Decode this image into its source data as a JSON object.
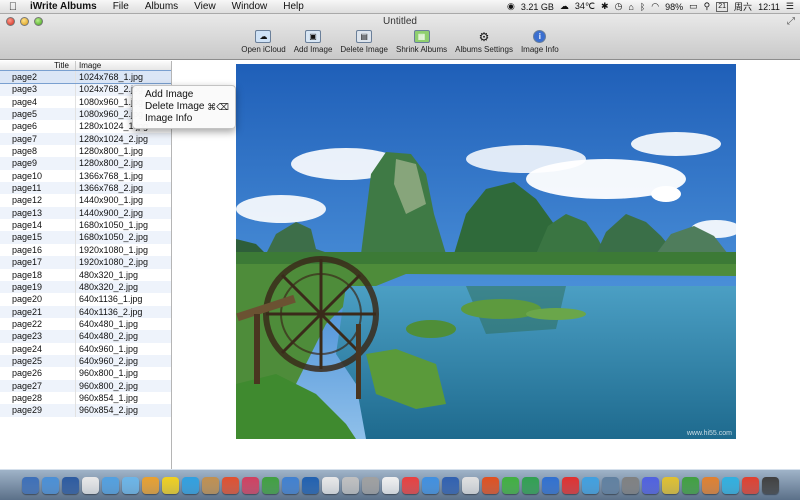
{
  "menubar": {
    "app_name": "iWrite Albums",
    "menus": [
      "File",
      "Albums",
      "View",
      "Window",
      "Help"
    ],
    "status": {
      "disk": "3.21 GB",
      "temperature": "34℃",
      "battery": "98%",
      "input_box": "21",
      "weekday": "周六",
      "time": "12:11"
    }
  },
  "window": {
    "title": "Untitled"
  },
  "toolbar": [
    {
      "label": "Open iCloud",
      "icon": "cloud-icon"
    },
    {
      "label": "Add Image",
      "icon": "add-image-icon"
    },
    {
      "label": "Delete Image",
      "icon": "delete-image-icon"
    },
    {
      "label": "Shrink Albums",
      "icon": "shrink-icon"
    },
    {
      "label": "Albums Settings",
      "icon": "gear-icon"
    },
    {
      "label": "Image Info",
      "icon": "info-icon"
    }
  ],
  "list": {
    "headers": {
      "title": "Title",
      "image": "Image"
    },
    "selected_index": 0,
    "rows": [
      {
        "title": "page2",
        "image": "1024x768_1.jpg"
      },
      {
        "title": "page3",
        "image": "1024x768_2.jpg"
      },
      {
        "title": "page4",
        "image": "1080x960_1.jpg"
      },
      {
        "title": "page5",
        "image": "1080x960_2.jpg"
      },
      {
        "title": "page6",
        "image": "1280x1024_1.jpg"
      },
      {
        "title": "page7",
        "image": "1280x1024_2.jpg"
      },
      {
        "title": "page8",
        "image": "1280x800_1.jpg"
      },
      {
        "title": "page9",
        "image": "1280x800_2.jpg"
      },
      {
        "title": "page10",
        "image": "1366x768_1.jpg"
      },
      {
        "title": "page11",
        "image": "1366x768_2.jpg"
      },
      {
        "title": "page12",
        "image": "1440x900_1.jpg"
      },
      {
        "title": "page13",
        "image": "1440x900_2.jpg"
      },
      {
        "title": "page14",
        "image": "1680x1050_1.jpg"
      },
      {
        "title": "page15",
        "image": "1680x1050_2.jpg"
      },
      {
        "title": "page16",
        "image": "1920x1080_1.jpg"
      },
      {
        "title": "page17",
        "image": "1920x1080_2.jpg"
      },
      {
        "title": "page18",
        "image": "480x320_1.jpg"
      },
      {
        "title": "page19",
        "image": "480x320_2.jpg"
      },
      {
        "title": "page20",
        "image": "640x1136_1.jpg"
      },
      {
        "title": "page21",
        "image": "640x1136_2.jpg"
      },
      {
        "title": "page22",
        "image": "640x480_1.jpg"
      },
      {
        "title": "page23",
        "image": "640x480_2.jpg"
      },
      {
        "title": "page24",
        "image": "640x960_1.jpg"
      },
      {
        "title": "page25",
        "image": "640x960_2.jpg"
      },
      {
        "title": "page26",
        "image": "960x800_1.jpg"
      },
      {
        "title": "page27",
        "image": "960x800_2.jpg"
      },
      {
        "title": "page28",
        "image": "960x854_1.jpg"
      },
      {
        "title": "page29",
        "image": "960x854_2.jpg"
      }
    ]
  },
  "context_menu": {
    "items": [
      {
        "label": "Add Image",
        "shortcut": ""
      },
      {
        "label": "Delete Image",
        "shortcut": "⌘⌫"
      },
      {
        "label": "Image Info",
        "shortcut": ""
      }
    ]
  },
  "preview": {
    "watermark": "www.hi55.com",
    "subject": "karst-landscape-waterwheel"
  },
  "dock": {
    "colors": [
      "#3d6fb8",
      "#4a8fd6",
      "#2c5aa0",
      "#e8e8e8",
      "#52a0e0",
      "#6bb5e8",
      "#e8a030",
      "#f0d020",
      "#30a0e0",
      "#c09050",
      "#e05030",
      "#d04060",
      "#40a040",
      "#4080d0",
      "#2060b0",
      "#e8e8e8",
      "#c0c0c0",
      "#a0a0a0",
      "#f0f0f0",
      "#e84040",
      "#4090e0",
      "#3060b0",
      "#e0e0e0",
      "#e05020",
      "#40b040",
      "#30a050",
      "#3070d0",
      "#e03030",
      "#40a0e0",
      "#6080a0",
      "#808080",
      "#5060e0",
      "#e0c030",
      "#40a040",
      "#e08030",
      "#30b0e0",
      "#e04030",
      "#404040"
    ]
  }
}
